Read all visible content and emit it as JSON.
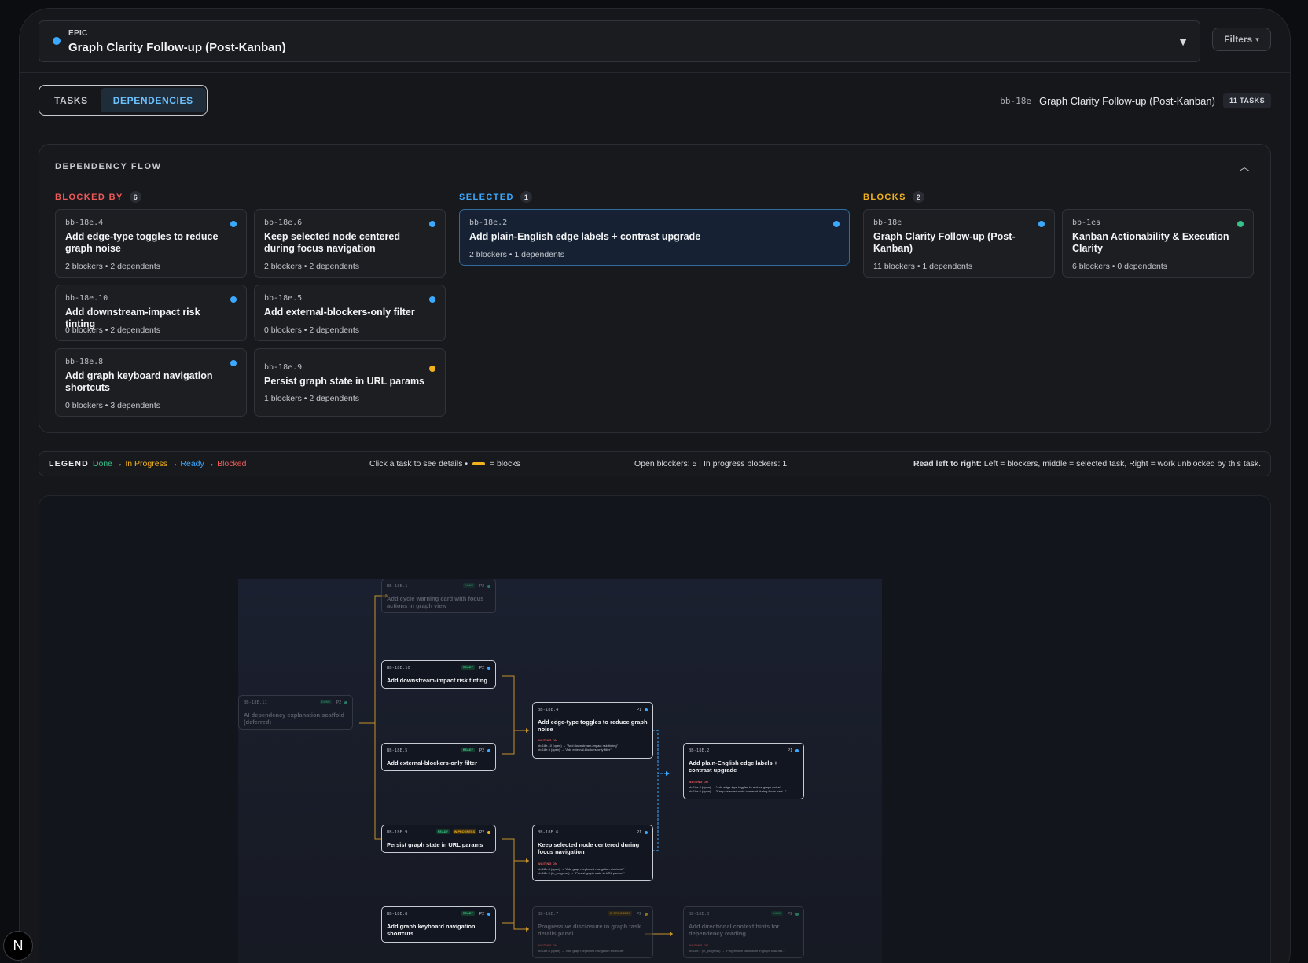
{
  "epic": {
    "kicker": "EPIC",
    "title": "Graph Clarity Follow-up (Post-Kanban)",
    "dot_color": "#3aa9ff",
    "caret_icon": "triangle-down-icon"
  },
  "filters": {
    "label": "Filters",
    "caret": "▾"
  },
  "tabs": [
    {
      "label": "TASKS",
      "active": false
    },
    {
      "label": "DEPENDENCIES",
      "active": true
    }
  ],
  "meta": {
    "id": "bb-18e",
    "name": "Graph Clarity Follow-up (Post-Kanban)",
    "count": "11 TASKS"
  },
  "flow": {
    "title": "DEPENDENCY FLOW",
    "collapse_icon": "chevron-up-icon",
    "blocked_by": {
      "label": "BLOCKED BY",
      "count": "6",
      "cards": [
        {
          "id": "bb-18e.4",
          "title": "Add edge-type toggles to reduce graph noise",
          "stats": "2 blockers • 2 dependents",
          "dot": "#3aa9ff"
        },
        {
          "id": "bb-18e.6",
          "title": "Keep selected node centered during focus navigation",
          "stats": "2 blockers • 2 dependents",
          "dot": "#3aa9ff"
        },
        {
          "id": "bb-18e.10",
          "title": "Add downstream-impact risk tinting",
          "stats": "0 blockers • 2 dependents",
          "dot": "#3aa9ff"
        },
        {
          "id": "bb-18e.5",
          "title": "Add external-blockers-only filter",
          "stats": "0 blockers • 2 dependents",
          "dot": "#3aa9ff"
        },
        {
          "id": "bb-18e.8",
          "title": "Add graph keyboard navigation shortcuts",
          "stats": "0 blockers • 3 dependents",
          "dot": "#3aa9ff"
        },
        {
          "id": "bb-18e.9",
          "title": "Persist graph state in URL params",
          "stats": "1 blockers • 2 dependents",
          "dot": "#f2b21e"
        }
      ]
    },
    "selected": {
      "label": "SELECTED",
      "count": "1",
      "card": {
        "id": "bb-18e.2",
        "title": "Add plain-English edge labels + contrast upgrade",
        "stats": "2 blockers • 1 dependents",
        "dot": "#3aa9ff"
      }
    },
    "blocks": {
      "label": "BLOCKS",
      "count": "2",
      "cards": [
        {
          "id": "bb-18e",
          "title": "Graph Clarity Follow-up (Post-Kanban)",
          "stats": "11 blockers • 1 dependents",
          "dot": "#3aa9ff"
        },
        {
          "id": "bb-1es",
          "title": "Kanban Actionability & Execution Clarity",
          "stats": "6 blockers • 0 dependents",
          "dot": "#37c08a"
        }
      ]
    }
  },
  "legend": {
    "key": "LEGEND",
    "done": "Done",
    "in_progress": "In Progress",
    "ready": "Ready",
    "blocked": "Blocked",
    "arrow": "→",
    "hint_prefix": "Click a task to see details •",
    "hint_suffix": "= blocks",
    "open_counts": "Open blockers: 5 | In progress blockers: 1",
    "read_key": "Read left to right:",
    "read_text": "Left = blockers, middle = selected task, Right = work unblocked by this task."
  },
  "graph": {
    "nodes": {
      "n11": {
        "id": "BB-18E.11",
        "pri": "P2",
        "badge": "DONE",
        "title": "AI dependency explanation scaffold (deferred)"
      },
      "n1": {
        "id": "BB-18E.1",
        "pri": "P2",
        "badge": "DONE",
        "title": "Add cycle warning card with focus actions in graph view"
      },
      "n10": {
        "id": "BB-18E.10",
        "pri": "P2",
        "badge": "READY",
        "title": "Add downstream-impact risk tinting"
      },
      "n5": {
        "id": "BB-18E.5",
        "pri": "P2",
        "badge": "READY",
        "title": "Add external-blockers-only filter"
      },
      "n9": {
        "id": "BB-18E.9",
        "pri": "P2",
        "badge": "READY",
        "badge2": "IN PROGRESS",
        "title": "Persist graph state in URL params"
      },
      "n8": {
        "id": "BB-18E.8",
        "pri": "P2",
        "badge": "READY",
        "title": "Add graph keyboard navigation shortcuts"
      },
      "n4": {
        "id": "BB-18E.4",
        "pri": "P1",
        "title": "Add edge-type toggles to reduce graph noise",
        "wait_label": "WAITING ON",
        "wait": [
          "bb-18e.10 (open) → \"Add downstream-impact risk tinting\"",
          "bb-18e.5 (open) → \"Add external-blockers-only filter\""
        ]
      },
      "n6": {
        "id": "BB-18E.6",
        "pri": "P1",
        "title": "Keep selected node centered during focus navigation",
        "wait_label": "WAITING ON",
        "wait": [
          "bb-18e.8 (open) → \"Add graph keyboard navigation shortcuts\"",
          "bb-18e.9 (in_progress) → \"Persist graph state in URL params\""
        ]
      },
      "n7": {
        "id": "BB-18E.7",
        "pri": "P2",
        "badge": "IN PROGRESS",
        "title": "Progressive disclosure in graph task details panel",
        "wait_label": "WAITING ON",
        "wait": [
          "bb-18e.8 (open) → \"Add graph keyboard navigation shortcuts\""
        ]
      },
      "n2": {
        "id": "BB-18E.2",
        "pri": "P1",
        "title": "Add plain-English edge labels + contrast upgrade",
        "wait_label": "WAITING ON",
        "wait": [
          "bb-18e.4 (open) → \"Add edge-type toggles to reduce graph noise\"",
          "bb-18e.6 (open) → \"Keep selected node centered during focus navi...\""
        ]
      },
      "n3": {
        "id": "BB-18E.3",
        "pri": "P2",
        "badge": "DONE",
        "title": "Add directional context hints for dependency reading",
        "wait_label": "WAITING ON",
        "wait": [
          "bb-18e.7 (in_progress) → \"Progressive disclosure in graph task det...\""
        ]
      }
    }
  },
  "logo": {
    "letter": "N"
  },
  "colors": {
    "done": "#37c08a",
    "in_progress": "#f2b21e",
    "ready": "#3aa9ff",
    "blocked": "#f05a5a",
    "edge": "#c8922b",
    "selected_edge": "#3aa9ff"
  }
}
